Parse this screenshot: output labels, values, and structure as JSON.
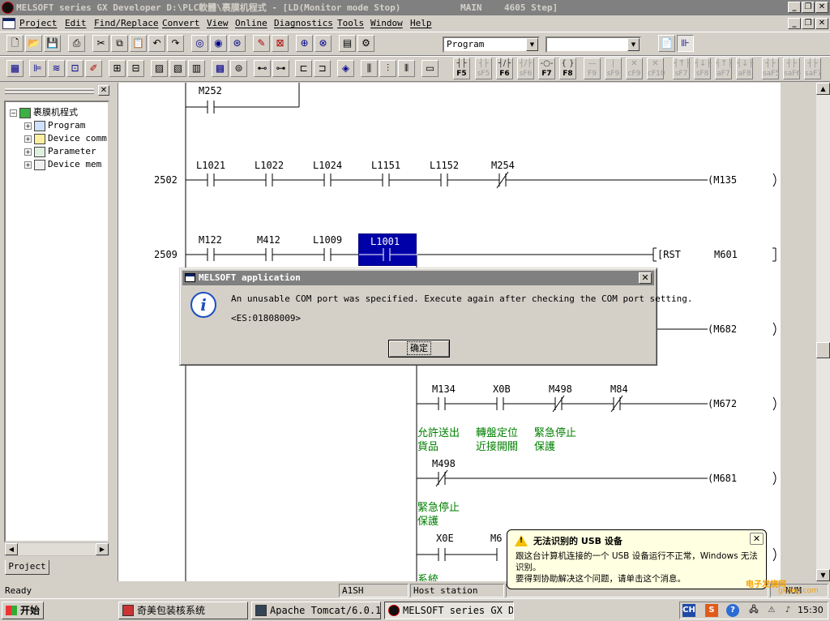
{
  "window": {
    "title": "MELSOFT series GX Developer D:\\PLC軟體\\裹膜机程式 - [LD(Monitor mode Stop)",
    "title_main": "MAIN",
    "title_step": "4605 Step]"
  },
  "menu": [
    "Project",
    "Edit",
    "Find/Replace",
    "Convert",
    "View",
    "Online",
    "Diagnostics",
    "Tools",
    "Window",
    "Help"
  ],
  "toolbar": {
    "mode_select": "Program",
    "second_select": "",
    "function_keys": [
      {
        "label": "F5",
        "enabled": true
      },
      {
        "label": "sF5",
        "enabled": false
      },
      {
        "label": "F6",
        "enabled": true
      },
      {
        "label": "sF6",
        "enabled": false
      },
      {
        "label": "F7",
        "enabled": true
      },
      {
        "label": "F8",
        "enabled": true
      },
      {
        "label": "F9",
        "enabled": false
      },
      {
        "label": "sF9",
        "enabled": false
      },
      {
        "label": "cF9",
        "enabled": false
      },
      {
        "label": "cF10",
        "enabled": false
      },
      {
        "label": "sF7",
        "enabled": false
      },
      {
        "label": "sF8",
        "enabled": false
      },
      {
        "label": "aF7",
        "enabled": false
      },
      {
        "label": "aF8",
        "enabled": false
      },
      {
        "label": "saF5",
        "enabled": false
      },
      {
        "label": "saF6",
        "enabled": false
      },
      {
        "label": "saF7",
        "enabled": false
      }
    ]
  },
  "project_tree": {
    "root": "裹膜机程式",
    "items": [
      "Program",
      "Device comm",
      "Parameter",
      "Device mem"
    ],
    "tab": "Project"
  },
  "ladder": {
    "top_contact": "M252",
    "rung_2502": {
      "step": "2502",
      "contacts": [
        "L1021",
        "L1022",
        "L1024",
        "L1151",
        "L1152",
        "M254"
      ],
      "coil": "(M135"
    },
    "rung_2509": {
      "step": "2509",
      "contacts": [
        "M122",
        "M412",
        "L1009",
        "L1001"
      ],
      "instruction": "[RST",
      "operand": "M601"
    },
    "coil_m682": "(M682",
    "rung_m672": {
      "contacts": [
        "M134",
        "X0B",
        "M498",
        "M84"
      ],
      "coil": "(M672"
    },
    "comments_1": [
      [
        "允許送出",
        "貨品"
      ],
      [
        "轉盤定位",
        "近接開關"
      ],
      [
        "緊急停止",
        "保護"
      ]
    ],
    "rung_m681": {
      "contact": "M498",
      "coil": "(M681"
    },
    "comments_2": [
      "緊急停止",
      "保護"
    ],
    "rung_last": {
      "contacts": [
        "X0E",
        "M6"
      ]
    },
    "comment_cut": "系統"
  },
  "dialog": {
    "title": "MELSOFT application",
    "message": "An unusable COM port was specified. Execute again after checking the COM port setting.",
    "code": "<ES:01808009>",
    "ok": "确定"
  },
  "balloon": {
    "title": "无法识别的 USB 设备",
    "line1": "跟这台计算机连接的一个 USB 设备运行不正常，Windows 无法识别。",
    "line2": "要得到协助解决这个问题，请单击这个消息。"
  },
  "status": {
    "ready": "Ready",
    "cpu": "A1SH",
    "station": "Host station",
    "mode": "NUM"
  },
  "taskbar": {
    "start": "开始",
    "items": [
      "奇美包装核系统",
      "Apache Tomcat/6.0.1...",
      "MELSOFT series GX D..."
    ],
    "ime": "CH",
    "clock": "15:30"
  },
  "watermark": {
    "line1": "电子发烧网",
    "line2": "gkong.com"
  }
}
